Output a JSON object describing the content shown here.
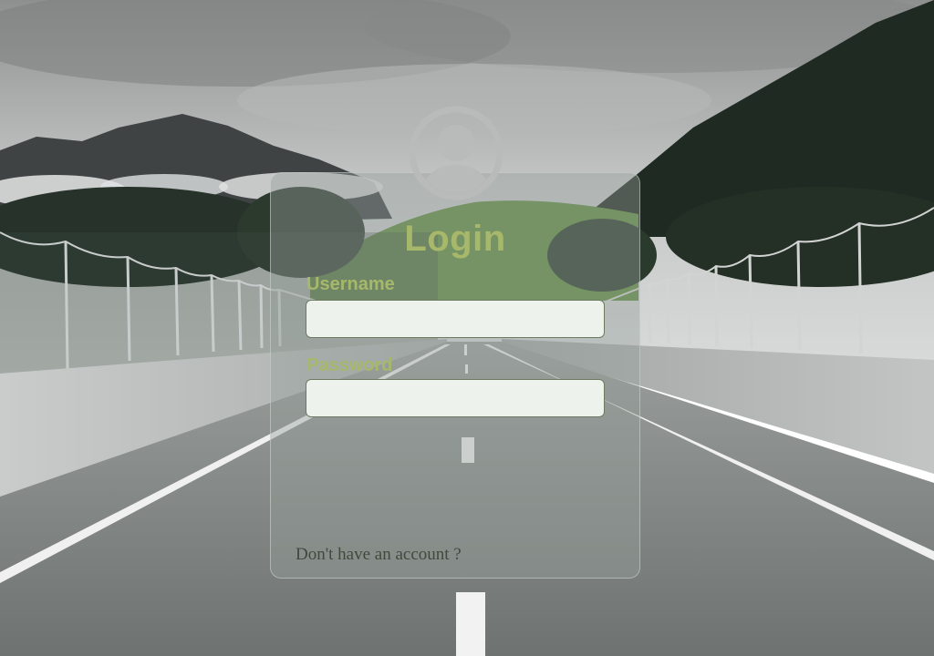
{
  "login_form": {
    "title": "Login",
    "username_label": "Username",
    "username_value": "",
    "password_label": "Password",
    "password_value": "",
    "signup_link": "Don't have an account ?"
  },
  "icons": {
    "avatar": "user-avatar-icon"
  },
  "colors": {
    "accent": "#a7b86a",
    "input_bg": "#edf3ec",
    "card_overlay": "rgba(150,160,155,0.42)",
    "link_text": "#3f4a3b"
  }
}
